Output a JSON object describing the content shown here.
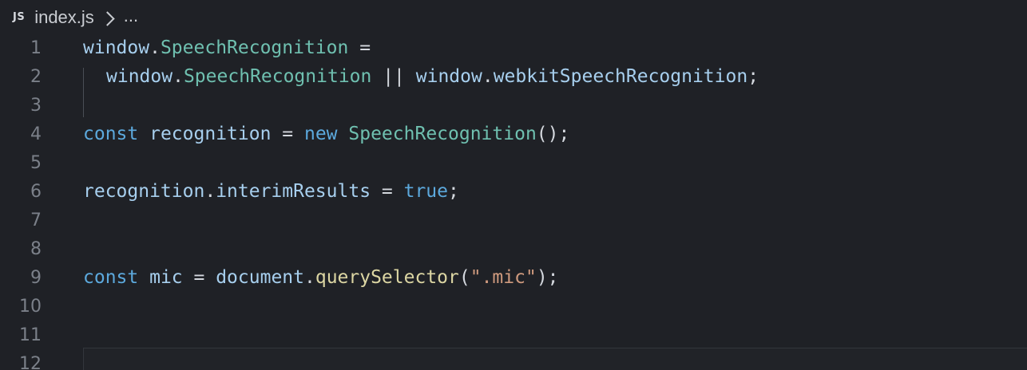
{
  "breadcrumb": {
    "icon_label": "JS",
    "file": "index.js",
    "more": "..."
  },
  "lines": [
    {
      "number": "1",
      "tokens": [
        {
          "t": "window",
          "c": "var"
        },
        {
          "t": ".",
          "c": "pun"
        },
        {
          "t": "SpeechRecognition",
          "c": "type"
        },
        {
          "t": " = ",
          "c": "op"
        }
      ]
    },
    {
      "number": "2",
      "tokens": [
        {
          "t": "window",
          "c": "var"
        },
        {
          "t": ".",
          "c": "pun"
        },
        {
          "t": "SpeechRecognition",
          "c": "type"
        },
        {
          "t": " || ",
          "c": "op"
        },
        {
          "t": "window",
          "c": "var"
        },
        {
          "t": ".",
          "c": "pun"
        },
        {
          "t": "webkitSpeechRecognition",
          "c": "var"
        },
        {
          "t": ";",
          "c": "pun"
        }
      ]
    },
    {
      "number": "3",
      "tokens": []
    },
    {
      "number": "4",
      "tokens": [
        {
          "t": "const",
          "c": "kw"
        },
        {
          "t": " ",
          "c": "pun"
        },
        {
          "t": "recognition",
          "c": "var"
        },
        {
          "t": " = ",
          "c": "op"
        },
        {
          "t": "new",
          "c": "kw"
        },
        {
          "t": " ",
          "c": "pun"
        },
        {
          "t": "SpeechRecognition",
          "c": "type"
        },
        {
          "t": "();",
          "c": "pun"
        }
      ]
    },
    {
      "number": "5",
      "tokens": []
    },
    {
      "number": "6",
      "tokens": [
        {
          "t": "recognition",
          "c": "var"
        },
        {
          "t": ".",
          "c": "pun"
        },
        {
          "t": "interimResults",
          "c": "var"
        },
        {
          "t": " = ",
          "c": "op"
        },
        {
          "t": "true",
          "c": "kw"
        },
        {
          "t": ";",
          "c": "pun"
        }
      ]
    },
    {
      "number": "7",
      "tokens": []
    },
    {
      "number": "8",
      "tokens": []
    },
    {
      "number": "9",
      "tokens": [
        {
          "t": "const",
          "c": "kw"
        },
        {
          "t": " ",
          "c": "pun"
        },
        {
          "t": "mic",
          "c": "var"
        },
        {
          "t": " = ",
          "c": "op"
        },
        {
          "t": "document",
          "c": "var"
        },
        {
          "t": ".",
          "c": "pun"
        },
        {
          "t": "querySelector",
          "c": "fn"
        },
        {
          "t": "(",
          "c": "pun"
        },
        {
          "t": "\".mic\"",
          "c": "str"
        },
        {
          "t": ");",
          "c": "pun"
        }
      ]
    },
    {
      "number": "10",
      "tokens": []
    },
    {
      "number": "11",
      "tokens": []
    },
    {
      "number": "12",
      "tokens": []
    }
  ]
}
